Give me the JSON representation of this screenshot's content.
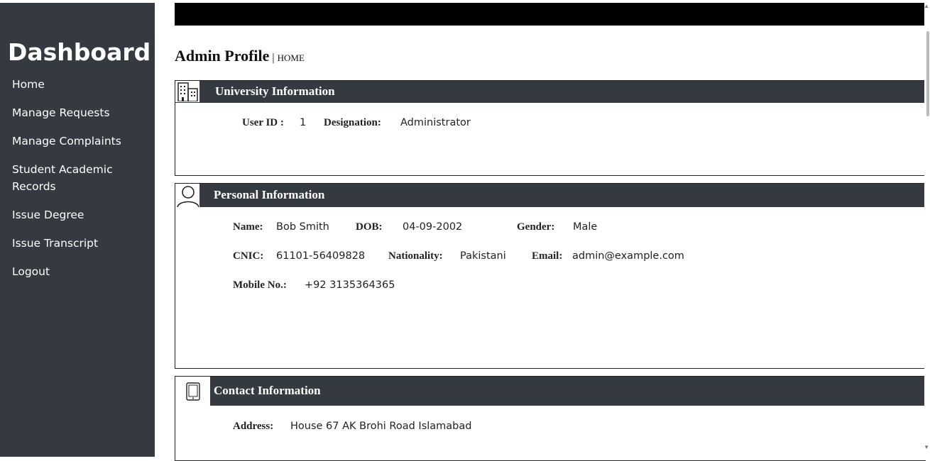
{
  "sidebar": {
    "brand": "Dashboard",
    "items": [
      {
        "label": "Home"
      },
      {
        "label": "Manage Requests"
      },
      {
        "label": "Manage Complaints"
      },
      {
        "label": "Student Academic Records"
      },
      {
        "label": "Issue Degree"
      },
      {
        "label": "Issue Transcript"
      },
      {
        "label": "Logout"
      }
    ]
  },
  "page": {
    "title": "Admin Profile",
    "separator": "|",
    "breadcrumb": "HOME"
  },
  "university": {
    "title": "University Information",
    "icon": "building-icon",
    "user_id_label": "User ID :",
    "user_id": "1",
    "designation_label": "Designation:",
    "designation": "Administrator"
  },
  "personal": {
    "title": "Personal Information",
    "icon": "user-icon",
    "name_label": "Name:",
    "name": "Bob Smith",
    "dob_label": "DOB:",
    "dob": "04-09-2002",
    "gender_label": "Gender:",
    "gender": "Male",
    "cnic_label": "CNIC:",
    "cnic": "61101-56409828",
    "nationality_label": "Nationality:",
    "nationality": "Pakistani",
    "email_label": "Email:",
    "email": "admin@example.com",
    "mobile_label": "Mobile No.:",
    "mobile": "+92 3135364365"
  },
  "contact": {
    "title": "Contact Information",
    "icon": "tablet-icon",
    "address_label": "Address:",
    "address": "House 67 AK Brohi Road Islamabad"
  },
  "colors": {
    "sidebar_bg": "#343a40",
    "header_bg": "#343a40",
    "topbar_bg": "#000000"
  }
}
